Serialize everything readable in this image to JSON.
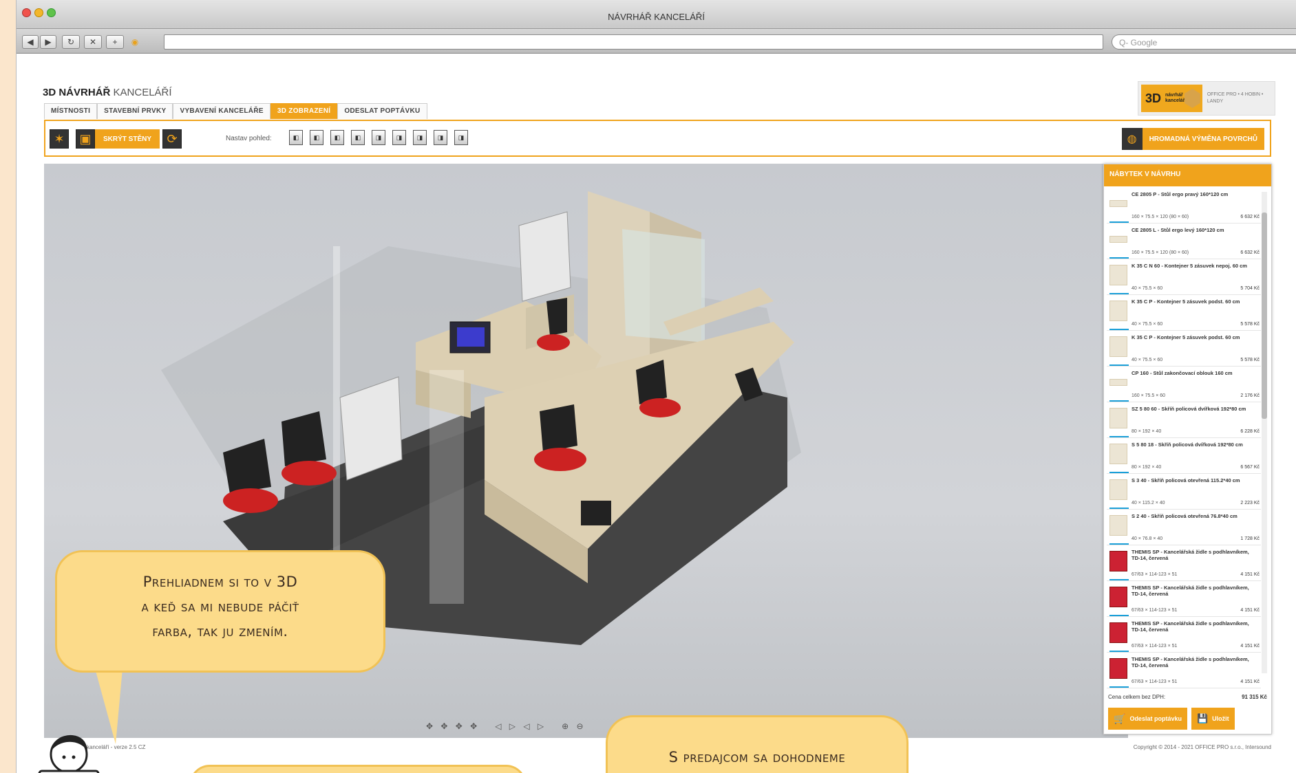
{
  "window": {
    "title": "NÁVRHÁŘ KANCELÁŘÍ"
  },
  "browser": {
    "search_placeholder": "Q- Google"
  },
  "app": {
    "logo_bold": "3D NÁVRHÁŘ",
    "logo_thin": "KANCELÁŘÍ",
    "brand_3d": "3D",
    "brand_text": "návrhář kanceláří",
    "brand_right": "OFFICE PRO • 4 HOBIN • LANDY"
  },
  "tabs": [
    "MÍSTNOSTI",
    "STAVEBNÍ PRVKY",
    "VYBAVENÍ KANCELÁŘE",
    "3D ZOBRAZENÍ",
    "ODESLAT POPTÁVKU"
  ],
  "bar": {
    "hide_walls": "SKRÝT STĚNY",
    "view_label": "Nastav pohled:",
    "bulk_change": "HROMADNÁ VÝMĚNA POVRCHŮ"
  },
  "panel": {
    "title": "NÁBYTEK V NÁVRHU",
    "items": [
      {
        "name": "CE 2805 P - Stůl ergo pravý 160*120 cm",
        "dim": "160 × 75.5 × 120 (80 × 60)",
        "price": "6 632 Kč",
        "kind": "desk"
      },
      {
        "name": "CE 2805 L - Stůl ergo levý 160*120 cm",
        "dim": "160 × 75.5 × 120 (80 × 60)",
        "price": "6 632 Kč",
        "kind": "desk"
      },
      {
        "name": "K 35 C N 60 - Kontejner 5 zásuvek nepoj. 60 cm",
        "dim": "40 × 75.5 × 60",
        "price": "5 704 Kč",
        "kind": "box"
      },
      {
        "name": "K 35 C P - Kontejner 5 zásuvek podst. 60 cm",
        "dim": "40 × 75.5 × 60",
        "price": "5 578 Kč",
        "kind": "box"
      },
      {
        "name": "K 35 C P - Kontejner 5 zásuvek podst. 60 cm",
        "dim": "40 × 75.5 × 60",
        "price": "5 578 Kč",
        "kind": "box"
      },
      {
        "name": "CP 160 - Stůl zakončovací oblouk 160 cm",
        "dim": "160 × 75.5 × 60",
        "price": "2 176 Kč",
        "kind": "desk"
      },
      {
        "name": "SZ 5 80 60 - Skříň policová dvířková 192*80 cm",
        "dim": "80 × 192 × 40",
        "price": "6 228 Kč",
        "kind": "box"
      },
      {
        "name": "S 5 80 18 - Skříň policová dvířková 192*80 cm",
        "dim": "80 × 192 × 40",
        "price": "6 567 Kč",
        "kind": "box"
      },
      {
        "name": "S 3 40 - Skříň policová otevřená 115.2*40 cm",
        "dim": "40 × 115.2 × 40",
        "price": "2 223 Kč",
        "kind": "box"
      },
      {
        "name": "S 2 40 - Skříň policová otevřená 76.8*40 cm",
        "dim": "40 × 76.8 × 40",
        "price": "1 728 Kč",
        "kind": "box"
      },
      {
        "name": "THEMIS SP - Kancelářská židle s podhlavníkem, TD-14, červená",
        "dim": "67/63 × 114-123 × 51",
        "price": "4 151 Kč",
        "kind": "chair"
      },
      {
        "name": "THEMIS SP - Kancelářská židle s podhlavníkem, TD-14, červená",
        "dim": "67/63 × 114-123 × 51",
        "price": "4 151 Kč",
        "kind": "chair"
      },
      {
        "name": "THEMIS SP - Kancelářská židle s podhlavníkem, TD-14, červená",
        "dim": "67/63 × 114-123 × 51",
        "price": "4 151 Kč",
        "kind": "chair"
      },
      {
        "name": "THEMIS SP - Kancelářská židle s podhlavníkem, TD-14, červená",
        "dim": "67/63 × 114-123 × 51",
        "price": "4 151 Kč",
        "kind": "chair"
      }
    ],
    "total_label": "Cena celkem bez DPH:",
    "total_value": "91 315 Kč",
    "send_btn": "Odeslat poptávku",
    "save_btn": "Uložit"
  },
  "footer": {
    "left": "kanceláří - verze 2.5 CZ",
    "right": "Copyright © 2014 - 2021 OFFICE PRO s.r.o., Intersound"
  },
  "bubbles": {
    "b1": [
      "Prehliadnem si to v 3D",
      "a keď sa mi nebude páčiť",
      "farba, tak ju zmením."
    ],
    "b2": "S predajcom sa dohodneme"
  },
  "colors": {
    "accent": "#f0a31c",
    "bubble": "#fcdb8a"
  }
}
